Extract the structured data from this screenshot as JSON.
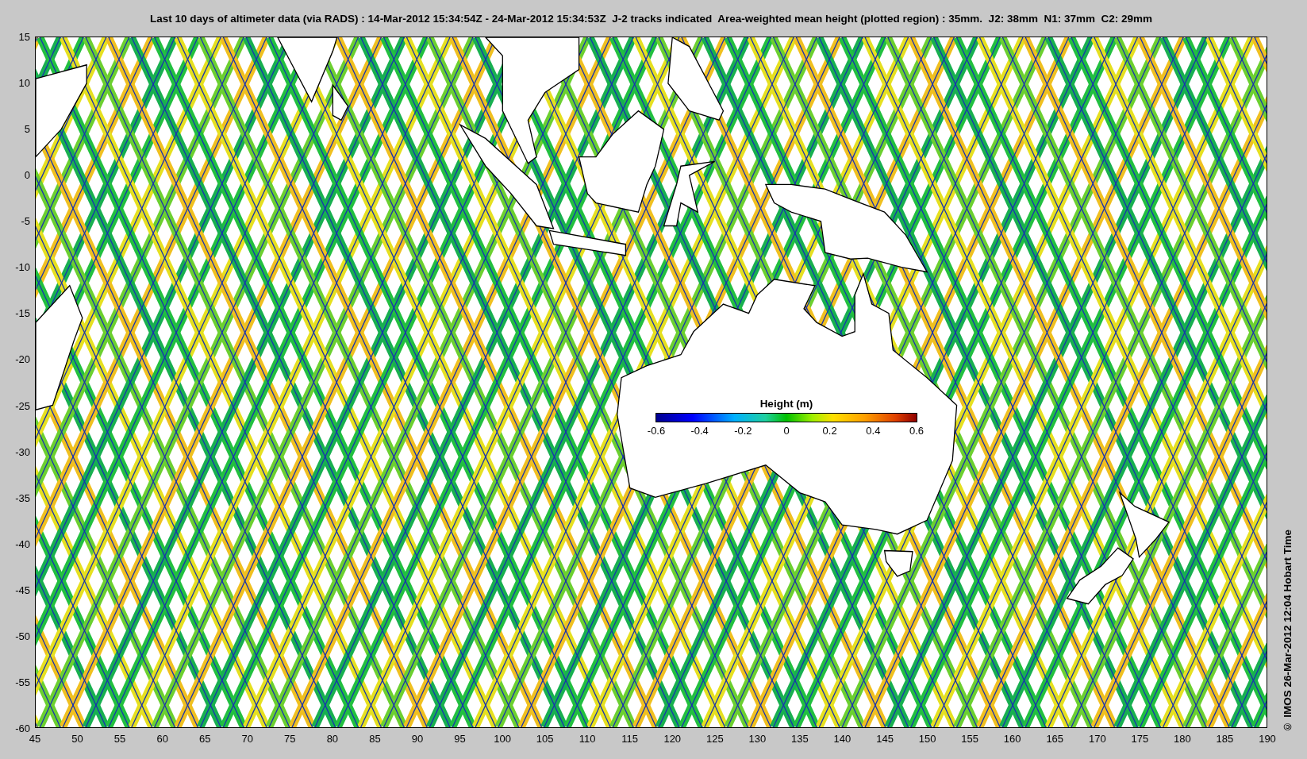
{
  "figure": {
    "title": "Last 10 days of altimeter data (via RADS) : 14-Mar-2012 15:34:54Z - 24-Mar-2012 15:34:53Z  J-2 tracks indicated  Area-weighted mean height (plotted region) : 35mm.  J2: 38mm  N1: 37mm  C2: 29mm",
    "credit": "© IMOS 26-Mar-2012 12:04 Hobart Time",
    "map": {
      "xtick_labels": [
        "45",
        "50",
        "55",
        "60",
        "65",
        "70",
        "75",
        "80",
        "85",
        "90",
        "95",
        "100",
        "105",
        "110",
        "115",
        "120",
        "125",
        "130",
        "135",
        "140",
        "145",
        "150",
        "155",
        "160",
        "165",
        "170",
        "175",
        "180",
        "185",
        "190"
      ],
      "ytick_labels": [
        "15",
        "10",
        "5",
        "0",
        "-5",
        "-10",
        "-15",
        "-20",
        "-25",
        "-30",
        "-35",
        "-40",
        "-45",
        "-50",
        "-55",
        "-60"
      ]
    },
    "colorbar": {
      "title": "Height (m)",
      "tick_labels": [
        "-0.6",
        "-0.4",
        "-0.2",
        "0",
        "0.2",
        "0.4",
        "0.6"
      ]
    }
  }
}
